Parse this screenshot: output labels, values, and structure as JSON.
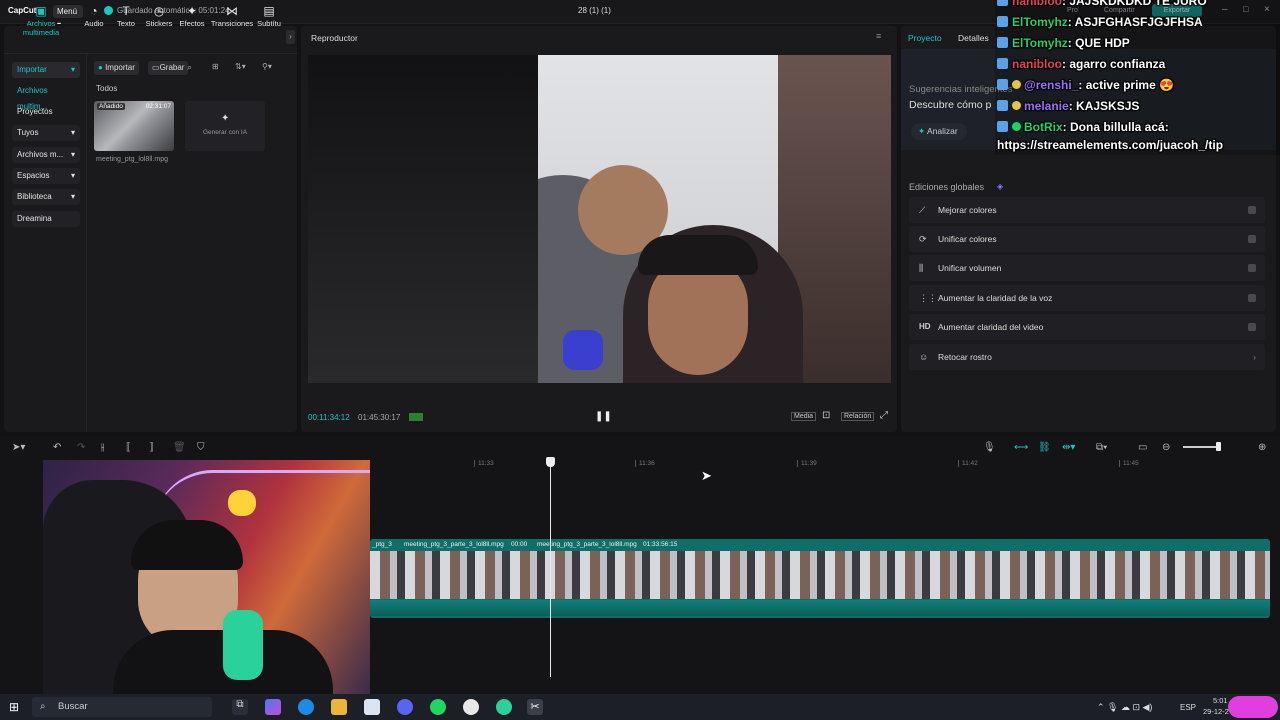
{
  "app": {
    "logo": "CapCut",
    "menu_label": "Menú",
    "autosave": "Guardado automático: 05:01:24",
    "project_title": "28 (1) (1)",
    "pro_label": "Pro",
    "share_label": "Compartir",
    "export_label": "Exportar"
  },
  "toolbar": {
    "tabs": [
      {
        "label": "Archivos multimedia",
        "icon": "media-icon"
      },
      {
        "label": "Audio",
        "icon": "audio-icon"
      },
      {
        "label": "Texto",
        "icon": "text-icon"
      },
      {
        "label": "Stickers",
        "icon": "sticker-icon"
      },
      {
        "label": "Efectos",
        "icon": "effects-icon"
      },
      {
        "label": "Transiciones",
        "icon": "transitions-icon"
      },
      {
        "label": "Subtítu",
        "icon": "subtitles-icon"
      }
    ]
  },
  "sidebar": {
    "items": [
      {
        "label": "Importar"
      },
      {
        "label": "Archivos multim..."
      },
      {
        "label": "Proyectos secun..."
      },
      {
        "label": "Tuyos"
      },
      {
        "label": "Archivos m..."
      },
      {
        "label": "Espacios"
      },
      {
        "label": "Biblioteca"
      },
      {
        "label": "Dreamina"
      }
    ]
  },
  "media": {
    "import_btn": "Importar",
    "record_btn": "Grabar",
    "filter_label": "Todos",
    "clip_added": "Añadido",
    "clip_duration": "02:31:07",
    "clip_name": "meeting_ptg_lol8ll.mpg",
    "ai_label": "Generar con IA"
  },
  "player": {
    "title": "Reproductor",
    "current_time": "00:11:34:12",
    "total_time": "01:45:30:17",
    "media_btn": "Media",
    "ratio_btn": "Relación"
  },
  "right_panel": {
    "tab_project": "Proyecto",
    "tab_details": "Detalles",
    "suggest_title": "Sugerencias inteligentes",
    "suggest_desc": "Descubre cómo p",
    "analyze_btn": "Analizar",
    "global_title": "Ediciones globales",
    "edits": [
      {
        "label": "Mejorar colores",
        "icon": "wand-icon"
      },
      {
        "label": "Unificar colores",
        "icon": "palette-icon"
      },
      {
        "label": "Unificar volumen",
        "icon": "volume-icon"
      },
      {
        "label": "Aumentar la claridad de la voz",
        "icon": "voice-icon"
      },
      {
        "label": "Aumentar claridad del video",
        "icon": "hd-icon"
      },
      {
        "label": "Retocar rostro",
        "icon": "face-icon"
      }
    ]
  },
  "chat": {
    "lines": [
      {
        "user": "nanibloo",
        "msg": ": JAJSKDKDKD TE JURO",
        "color": "#e0435a"
      },
      {
        "user": "ElTomyhz",
        "msg": ": ASJFGHASFJGJFHSA",
        "color": "#1fd16b"
      },
      {
        "user": "ElTomyhz",
        "msg": ": QUE HDP",
        "color": "#1fd16b"
      },
      {
        "user": "nanibloo",
        "msg": ": agarro confianza",
        "color": "#e0435a"
      },
      {
        "user": "@renshi_",
        "msg": ": active prime 😍",
        "color": "#9b6dff"
      },
      {
        "user": "melanie",
        "msg": ": KAJSKSJS",
        "color": "#9b6dff"
      },
      {
        "user": "BotRix",
        "msg": ": Dona billulla acá:",
        "color": "#1fd16b"
      },
      {
        "user": "",
        "msg": "https://streamelements.com/juacoh_/tip",
        "color": "#ffffff"
      }
    ]
  },
  "timeline": {
    "ticks": [
      "11:33",
      "11:36",
      "11:39",
      "11:42",
      "11:45"
    ],
    "clip_label_1": "_ptg_3",
    "clip_label_2": "meeting_ptg_3_parte_3_lol8ll.mpg",
    "clip_label_3": "00:00",
    "clip_label_4": "meeting_ptg_3_parte_3_lol8ll.mpg",
    "clip_label_5": "01:33:56:15",
    "accent": "#19c7c3"
  },
  "taskbar": {
    "search": "Buscar",
    "lang": "ESP",
    "time": "5:01",
    "date": "29-12-2"
  }
}
